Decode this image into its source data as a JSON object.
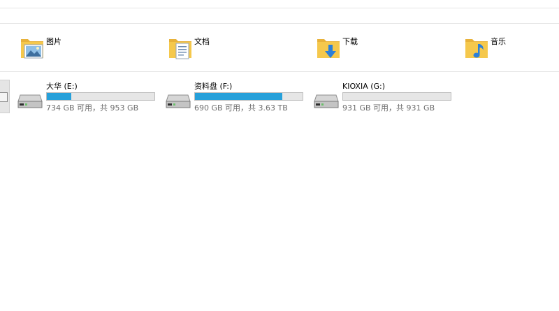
{
  "folders": [
    {
      "label": "图片",
      "icon": "pictures-folder-icon"
    },
    {
      "label": "文档",
      "icon": "documents-folder-icon"
    },
    {
      "label": "下载",
      "icon": "downloads-folder-icon"
    },
    {
      "label": "音乐",
      "icon": "music-folder-icon"
    }
  ],
  "drives": [
    {
      "label": "大华 (E:)",
      "info": "734 GB 可用，共 953 GB",
      "used_fraction": 0.23
    },
    {
      "label": "资料盘 (F:)",
      "info": "690 GB 可用，共 3.63 TB",
      "used_fraction": 0.81
    },
    {
      "label": "KIOXIA (G:)",
      "info": "931 GB 可用，共 931 GB",
      "used_fraction": 0.0
    }
  ],
  "colors": {
    "usage_bar_fill": "#26a0da",
    "usage_bar_track": "#e6e6e6",
    "folder_yellow": "#f5c84c",
    "download_arrow": "#2b7fd8",
    "music_note": "#2b7fd8"
  }
}
